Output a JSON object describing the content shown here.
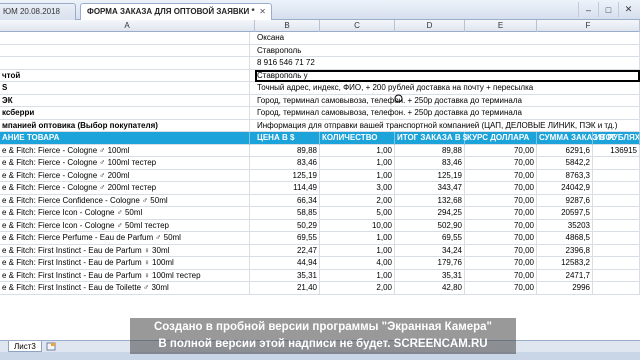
{
  "tabs": [
    {
      "label": "ЮМ 20.08.2018"
    },
    {
      "label": "ФОРМА ЗАКАЗА ДЛЯ  ОПТОВОЙ ЗАЯВКИ *"
    }
  ],
  "window_controls": [
    "–",
    "□",
    "✕"
  ],
  "columns": [
    "A",
    "B",
    "C",
    "D",
    "E",
    "F"
  ],
  "info_rows": [
    {
      "label": "",
      "value": "Оксана"
    },
    {
      "label": "",
      "value": "Ставрополь"
    },
    {
      "label": "",
      "value": "8 916 546 71 72"
    },
    {
      "label": "чтой",
      "value": "Ставрополь у"
    },
    {
      "label": "S",
      "value": "Точный адрес, индекс, ФИО, + 200 рублей доставка на почту + пересылка"
    },
    {
      "label": "ЭК",
      "value": "Город, терминал самовывоза, телефон. + 250р доставка до терминала"
    },
    {
      "label": "ксберри",
      "value": "Город, терминал самовывоза, телефон. + 250р доставка до терминала"
    },
    {
      "label": "мпанией оптовика (Выбор покупателя)",
      "value": "Информация для отправки вашей транспортной компанией (ЦАП, ДЕЛОВЫЕ ЛИНИК, ПЭК и тд.)"
    }
  ],
  "table": {
    "headers": [
      "АНИЕ ТОВАРА",
      "ЦЕНА В $",
      "КОЛИЧЕСТВО",
      "ИТОГ ЗАКАЗА В $",
      "КУРС ДОЛЛАРА",
      "СУММА ЗАКАЗ В РУБЛЯХ",
      "ИТОГ"
    ],
    "rows": [
      [
        "e & Fitch: Fierce - Cologne ♂ 100ml",
        "89,88",
        "1,00",
        "89,88",
        "70,00",
        "6291,6",
        "136915"
      ],
      [
        "e & Fitch: Fierce - Cologne ♂ 100ml тестер",
        "83,46",
        "1,00",
        "83,46",
        "70,00",
        "5842,2",
        ""
      ],
      [
        "e & Fitch: Fierce - Cologne ♂ 200ml",
        "125,19",
        "1,00",
        "125,19",
        "70,00",
        "8763,3",
        ""
      ],
      [
        "e & Fitch: Fierce - Cologne ♂ 200ml тестер",
        "114,49",
        "3,00",
        "343,47",
        "70,00",
        "24042,9",
        ""
      ],
      [
        "e & Fitch: Fierce Confidence - Cologne ♂ 50ml",
        "66,34",
        "2,00",
        "132,68",
        "70,00",
        "9287,6",
        ""
      ],
      [
        "e & Fitch: Fierce Icon - Cologne ♂ 50ml",
        "58,85",
        "5,00",
        "294,25",
        "70,00",
        "20597,5",
        ""
      ],
      [
        "e & Fitch: Fierce Icon - Cologne ♂ 50ml тестер",
        "50,29",
        "10,00",
        "502,90",
        "70,00",
        "35203",
        ""
      ],
      [
        "e & Fitch: Fierce Perfume - Eau de Parfum ♂ 50ml",
        "69,55",
        "1,00",
        "69,55",
        "70,00",
        "4868,5",
        ""
      ],
      [
        "e & Fitch: First Instinct - Eau de Parfum ♀ 30ml",
        "22,47",
        "1,00",
        "34,24",
        "70,00",
        "2396,8",
        ""
      ],
      [
        "e & Fitch: First Instinct - Eau de Parfum ♀ 100ml",
        "44,94",
        "4,00",
        "179,76",
        "70,00",
        "12583,2",
        ""
      ],
      [
        "e & Fitch: First Instinct - Eau de Parfum ♀ 100ml тестер",
        "35,31",
        "1,00",
        "35,31",
        "70,00",
        "2471,7",
        ""
      ],
      [
        "e & Fitch: First Instinct - Eau de Toilette ♂ 30ml",
        "21,40",
        "2,00",
        "42,80",
        "70,00",
        "2996",
        ""
      ]
    ]
  },
  "sheet_tab": "Лист3",
  "watermark": {
    "line1": "Создано в пробной версии программы \"Экранная Камера\"",
    "line2": "В полной версии этой надписи не будет. SCREENCAM.RU"
  },
  "colors": {
    "header_accent": "#1ca3da",
    "watermark_bg": "#464646"
  }
}
